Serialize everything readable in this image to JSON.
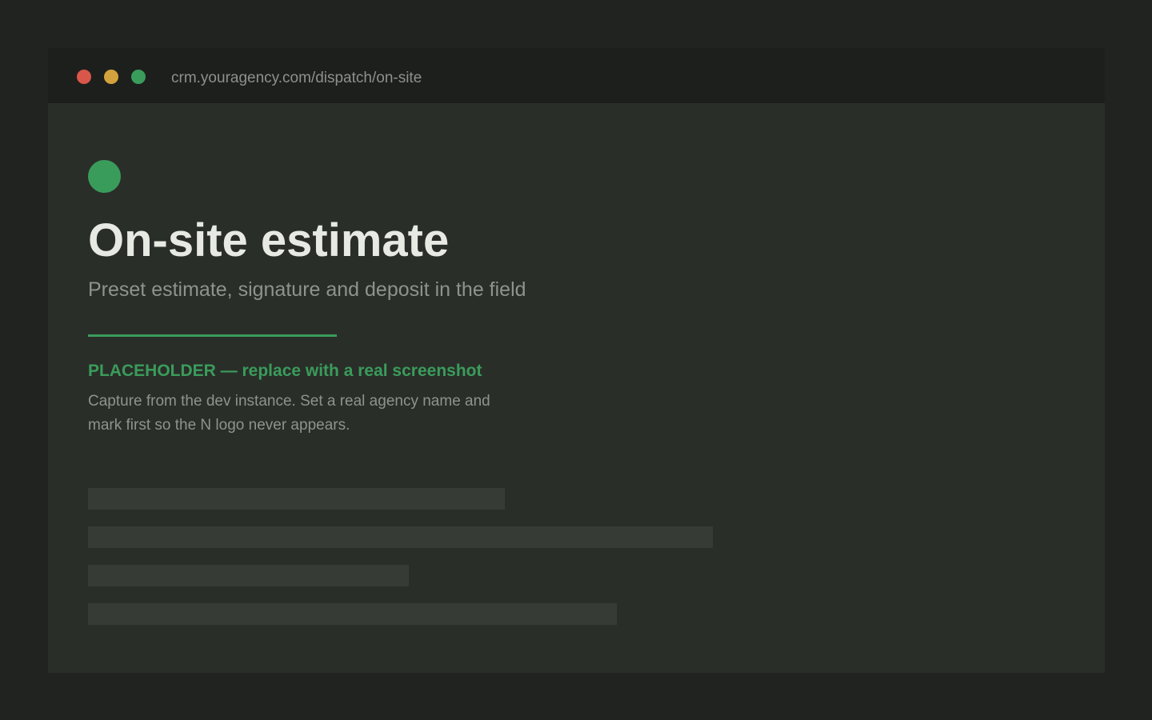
{
  "browser": {
    "url": "crm.youragency.com/dispatch/on-site",
    "controls": {
      "close_color": "#d9574a",
      "minimize_color": "#d4a23d",
      "maximize_color": "#3a9c5b"
    }
  },
  "page": {
    "title": "On-site estimate",
    "subtitle": "Preset estimate, signature and deposit in the field",
    "status_color": "#3a9c5b",
    "accent_color": "#3a9c5b"
  },
  "notice": {
    "title": "PLACEHOLDER — replace with a real screenshot",
    "body": "Capture from the dev instance. Set a real agency name and mark first so the N logo never appears."
  },
  "skeleton": {
    "line_count": 4,
    "color": "#363b35"
  }
}
